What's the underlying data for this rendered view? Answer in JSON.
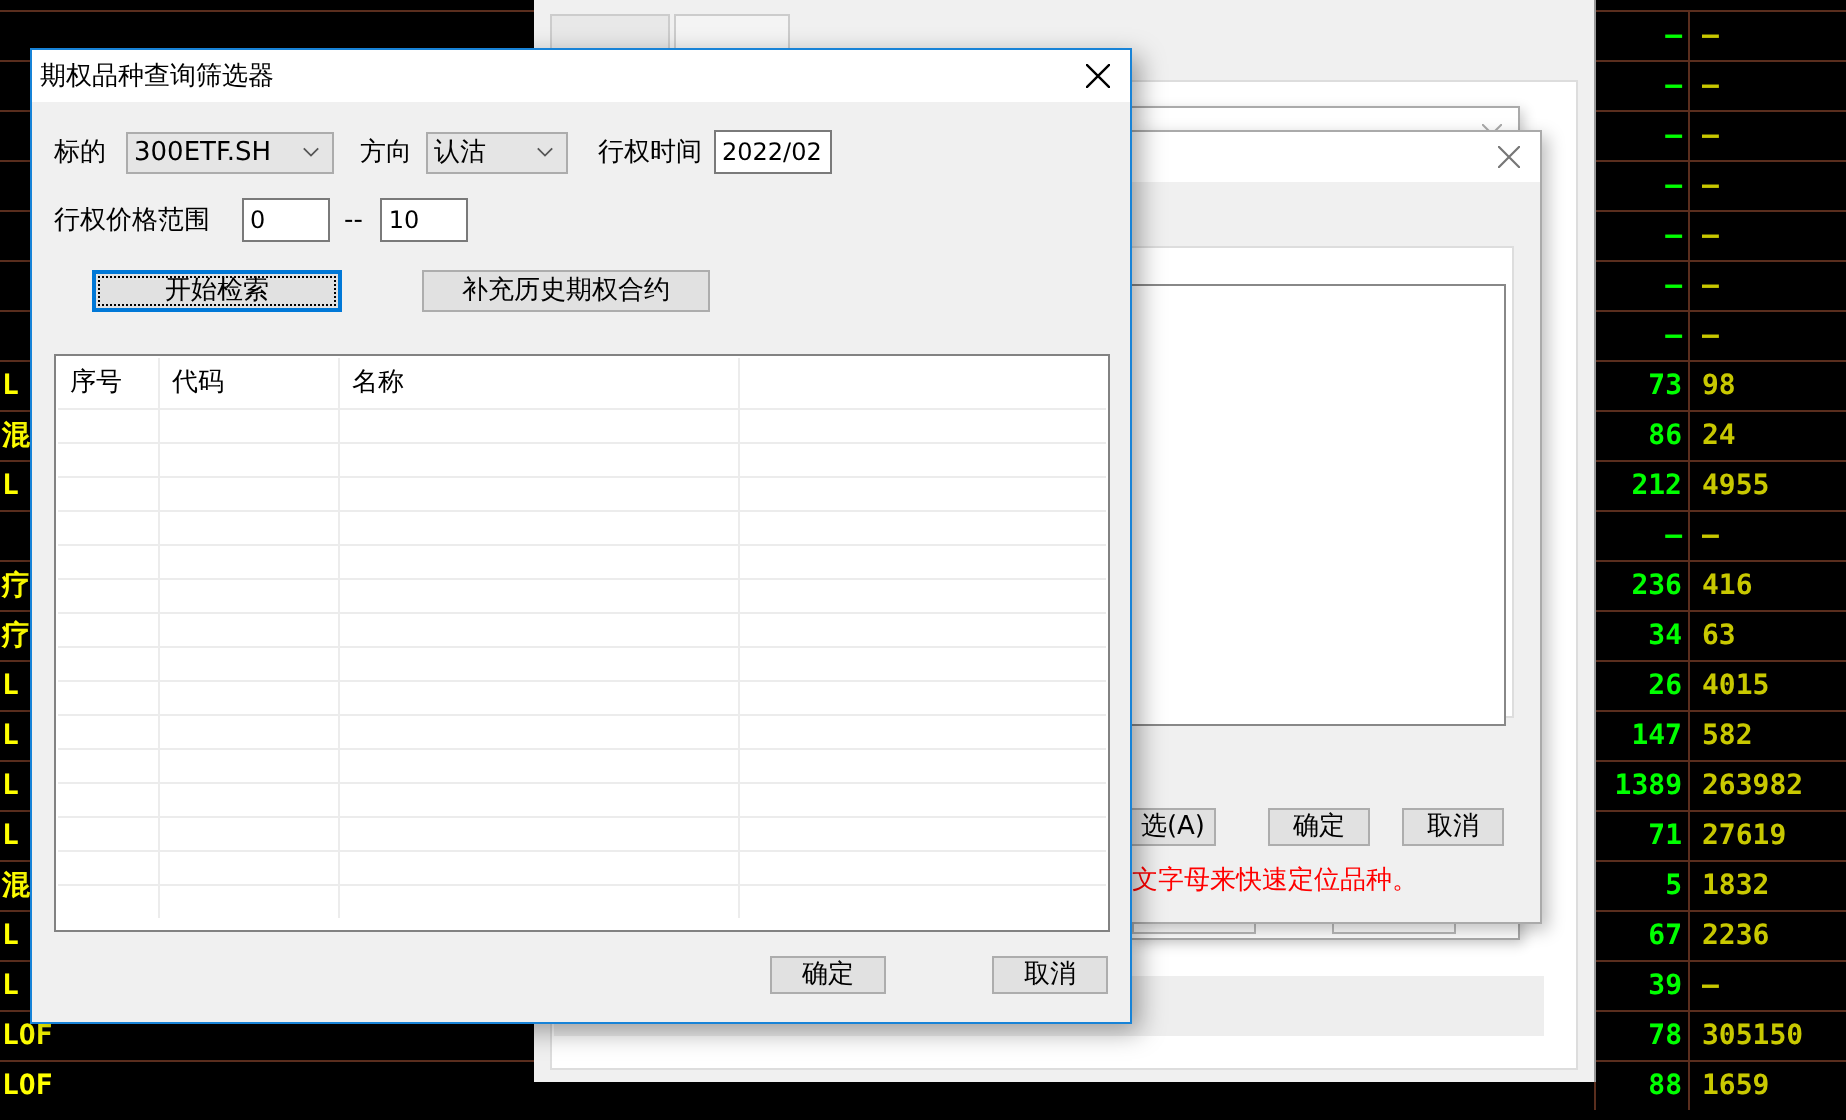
{
  "quote_table": {
    "rows": [
      {
        "column_2": "—",
        "column_3": "—"
      },
      {
        "column_2": "—",
        "column_3": "—"
      },
      {
        "column_2": "—",
        "column_3": "—"
      },
      {
        "column_2": "—",
        "column_3": "—"
      },
      {
        "column_2": "—",
        "column_3": "—"
      },
      {
        "column_2": "—",
        "column_3": "—"
      },
      {
        "column_2": "—",
        "column_3": "—"
      },
      {
        "column_1": "L",
        "column_2": "73",
        "column_3": "98"
      },
      {
        "column_1": "混",
        "column_2": "86",
        "column_3": "24"
      },
      {
        "column_1": "L",
        "column_2": "212",
        "column_3": "4955"
      },
      {
        "column_2": "—",
        "column_3": "—"
      },
      {
        "column_1": "疗",
        "column_2": "236",
        "column_3": "416"
      },
      {
        "column_1": "疗",
        "column_2": "34",
        "column_3": "63"
      },
      {
        "column_1": "L",
        "column_2": "26",
        "column_3": "4015"
      },
      {
        "column_1": "L",
        "column_2": "147",
        "column_3": "582"
      },
      {
        "column_1": "L",
        "column_2": "1389",
        "column_3": "263982"
      },
      {
        "column_1": "L",
        "column_2": "71",
        "column_3": "27619"
      },
      {
        "column_1": "混",
        "column_2": "5",
        "column_3": "1832"
      },
      {
        "column_1": "L",
        "column_2": "67",
        "column_3": "2236"
      },
      {
        "column_1": "L",
        "column_2": "39",
        "column_3": "—"
      },
      {
        "column_1": "LOF",
        "column_2": "78",
        "column_3": "305150"
      },
      {
        "column_1": "LOF",
        "column_2": "88",
        "column_3": "1659"
      }
    ]
  },
  "back_dialog": {
    "buttons": [
      "选(A)",
      "确定",
      "取消"
    ],
    "hint": "文字母来快速定位品种。"
  },
  "dialog": {
    "title": "期权品种查询筛选器",
    "underlying": {
      "label": "标的",
      "value": "300ETF.SH"
    },
    "direction": {
      "label": "方向",
      "value": "认沽"
    },
    "expiry": {
      "label": "行权时间",
      "value": "2022/02"
    },
    "strike_range": {
      "label": "行权价格范围",
      "from": "0",
      "separator": "--",
      "to": "10"
    },
    "actions": [
      {
        "label": "开始检索",
        "focused": true
      },
      {
        "label": "补充历史期权合约",
        "focused": false
      }
    ],
    "table": {
      "columns": [
        "序号",
        "代码",
        "名称"
      ]
    },
    "buttons": [
      "确定",
      "取消"
    ]
  }
}
